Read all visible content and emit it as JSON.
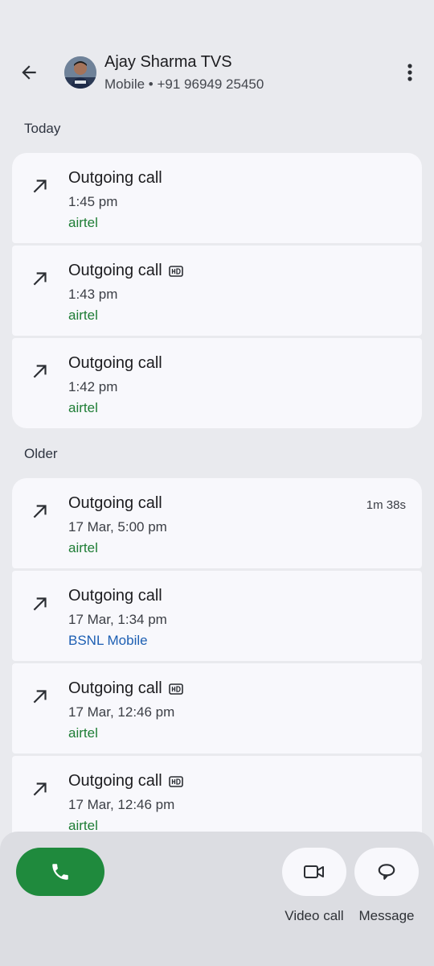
{
  "header": {
    "name": "Ajay Sharma TVS",
    "subtitle": "Mobile • +91 96949 25450"
  },
  "sections": {
    "today": "Today",
    "older": "Older"
  },
  "today_calls": [
    {
      "type": "Outgoing call",
      "time": "1:45 pm",
      "carrier": "airtel",
      "hd": false
    },
    {
      "type": "Outgoing call",
      "time": "1:43 pm",
      "carrier": "airtel",
      "hd": true
    },
    {
      "type": "Outgoing call",
      "time": "1:42 pm",
      "carrier": "airtel",
      "hd": false
    }
  ],
  "older_calls": [
    {
      "type": "Outgoing call",
      "time": "17 Mar, 5:00 pm",
      "carrier": "airtel",
      "duration": "1m 38s",
      "hd": false
    },
    {
      "type": "Outgoing call",
      "time": "17 Mar, 1:34 pm",
      "carrier": "BSNL Mobile",
      "hd": false
    },
    {
      "type": "Outgoing call",
      "time": "17 Mar, 12:46 pm",
      "carrier": "airtel",
      "hd": true
    },
    {
      "type": "Outgoing call",
      "time": "17 Mar, 12:46 pm",
      "carrier": "airtel",
      "hd": true
    }
  ],
  "actions": {
    "video_call": "Video call",
    "message": "Message"
  },
  "colors": {
    "background": "#e9eaee",
    "card": "#f8f8fc",
    "airtel": "#1e7d35",
    "bsnl": "#1d5fb3",
    "call_button": "#1f8a3d"
  },
  "icons": [
    "back-arrow-icon",
    "more-vert-icon",
    "outgoing-call-icon",
    "hd-icon",
    "phone-icon",
    "videocam-icon",
    "message-icon"
  ]
}
